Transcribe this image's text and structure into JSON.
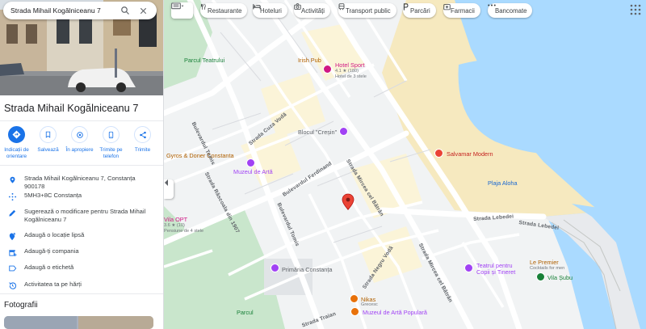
{
  "search": {
    "value": "Strada Mihail Kogălniceanu 7"
  },
  "place": {
    "title": "Strada Mihail Kogălniceanu 7",
    "actions": [
      {
        "label": "Indicații de orientare",
        "icon": "directions-icon"
      },
      {
        "label": "Salvează",
        "icon": "bookmark-icon"
      },
      {
        "label": "În apropiere",
        "icon": "nearby-icon"
      },
      {
        "label": "Trimite pe telefon",
        "icon": "phone-icon"
      },
      {
        "label": "Trimite",
        "icon": "share-icon"
      }
    ],
    "info": [
      {
        "text": "Strada Mihail Kogălniceanu 7, Constanța 900178",
        "icon": "location-pin-icon"
      },
      {
        "text": "5MH3+8C Constanța",
        "icon": "plus-code-icon"
      },
      {
        "text": "Sugerează o modificare pentru Strada Mihail Kogălniceanu 7",
        "icon": "edit-pencil-icon"
      },
      {
        "text": "Adaugă o locație lipsă",
        "icon": "add-location-icon"
      },
      {
        "text": "Adaugă-ți compania",
        "icon": "add-business-icon"
      },
      {
        "text": "Adaugă o etichetă",
        "icon": "label-icon"
      },
      {
        "text": "Activitatea ta pe hărți",
        "icon": "history-icon"
      }
    ],
    "photos_title": "Fotografii"
  },
  "map": {
    "chips": [
      {
        "label": "Restaurante",
        "icon": "restaurant-icon"
      },
      {
        "label": "Hoteluri",
        "icon": "hotel-icon"
      },
      {
        "label": "Activități",
        "icon": "camera-icon"
      },
      {
        "label": "Transport public",
        "icon": "transit-icon"
      },
      {
        "label": "Parcări",
        "icon": "parking-icon"
      },
      {
        "label": "Farmacii",
        "icon": "pharmacy-icon"
      },
      {
        "label": "Bancomate",
        "icon": "atm-icon"
      }
    ],
    "streets": {
      "tomis": "Bulevardul Tomis",
      "cuza": "Strada Cuza Vodă",
      "ferdinand": "Bulevardul Ferdinand",
      "rascoala": "Strada Răscoala din 1907",
      "mircea1": "Strada Mircea cel Bătrân",
      "mircea2": "Strada Mircea cel Bătrân",
      "lebedei1": "Strada Lebedei",
      "lebedei2": "Strada Lebedei",
      "tomis2": "Bulevardul Tomis",
      "negru": "Strada Negru Vodă",
      "traian": "Strada Traian"
    },
    "pois": {
      "parc_teatrului": "Parcul Teatrului",
      "irish_pub": "Irish Pub",
      "hotel_sport": "Hotel Sport",
      "hotel_sport_rating": "4.1 ★ (180)",
      "hotel_sport_sub": "Hotel de 3 stele",
      "blocul_cresin": "Blocul \"Creșin\"",
      "gyros": "Gyros & Doner Constanta",
      "muzeu_arta": "Muzeul de Artă",
      "salvamar": "Salvamar Modern",
      "plaja": "Plaja Aloha",
      "vila_opt": "Vila OPT",
      "vila_opt_rating": "3.6 ★ (10)",
      "vila_opt_sub": "Pensiune de 4 stele",
      "primaria": "Primăria Constanța",
      "teatrul": "Teatrul pentru Copii și Tineret",
      "le_premier": "Le Premier",
      "le_premier_sub": "Cocktails for men",
      "vila_subu": "Vila Șubu",
      "nikas": "Nikas",
      "nikas_sub": "Grecesc",
      "muzeu_arta_pop": "Muzeul de Artă Populară",
      "parcul2": "Parcul"
    }
  }
}
